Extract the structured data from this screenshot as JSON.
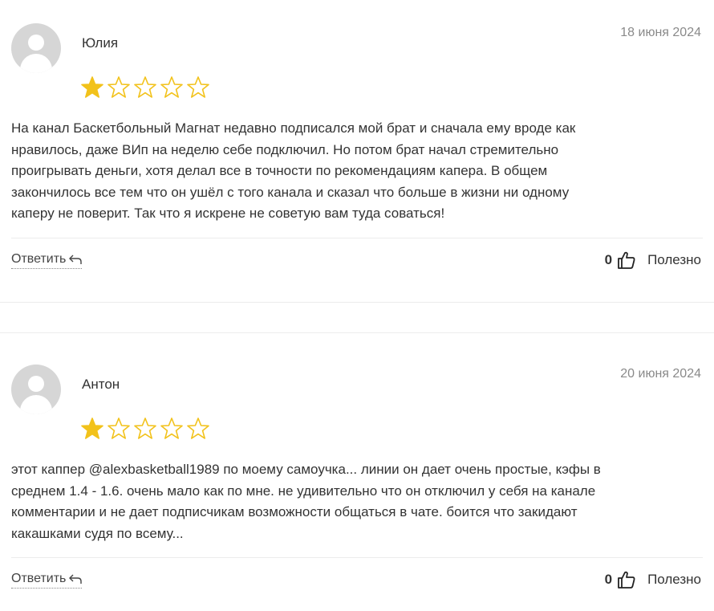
{
  "colors": {
    "star_filled": "#f2c21b",
    "star_empty_outline": "#f2c21b",
    "divider": "#ececec"
  },
  "reviews": [
    {
      "author": "Юлия",
      "date": "18 июня 2024",
      "rating": 1,
      "max_rating": 5,
      "text": "На канал Баскетбольный Магнат недавно подписался мой брат и сначала ему вроде как\nнравилось, даже ВИп на неделю себе подключил. Но потом брат начал стремительно\nпроигрывать деньги, хотя делал все в точности по рекомендациям капера. В общем\nзакончилось все тем что он ушёл с того канала и сказал что больше в жизни ни одному\nкаперу не поверит. Так что я искрене не советую вам туда соваться!",
      "reply_label": "Ответить",
      "helpful_count": "0",
      "helpful_label": "Полезно"
    },
    {
      "author": "Антон",
      "date": "20 июня 2024",
      "rating": 1,
      "max_rating": 5,
      "text": "этот каппер @alexbasketball1989 по моему самоучка... линии он дает очень простые, кэфы в\nсреднем 1.4 - 1.6. очень мало как по мне. не удивительно что он отключил у себя на канале\nкомментарии и не дает подписчикам возможности общаться в чате. боится что закидают\nкакашками судя по всему...",
      "reply_label": "Ответить",
      "helpful_count": "0",
      "helpful_label": "Полезно"
    }
  ]
}
